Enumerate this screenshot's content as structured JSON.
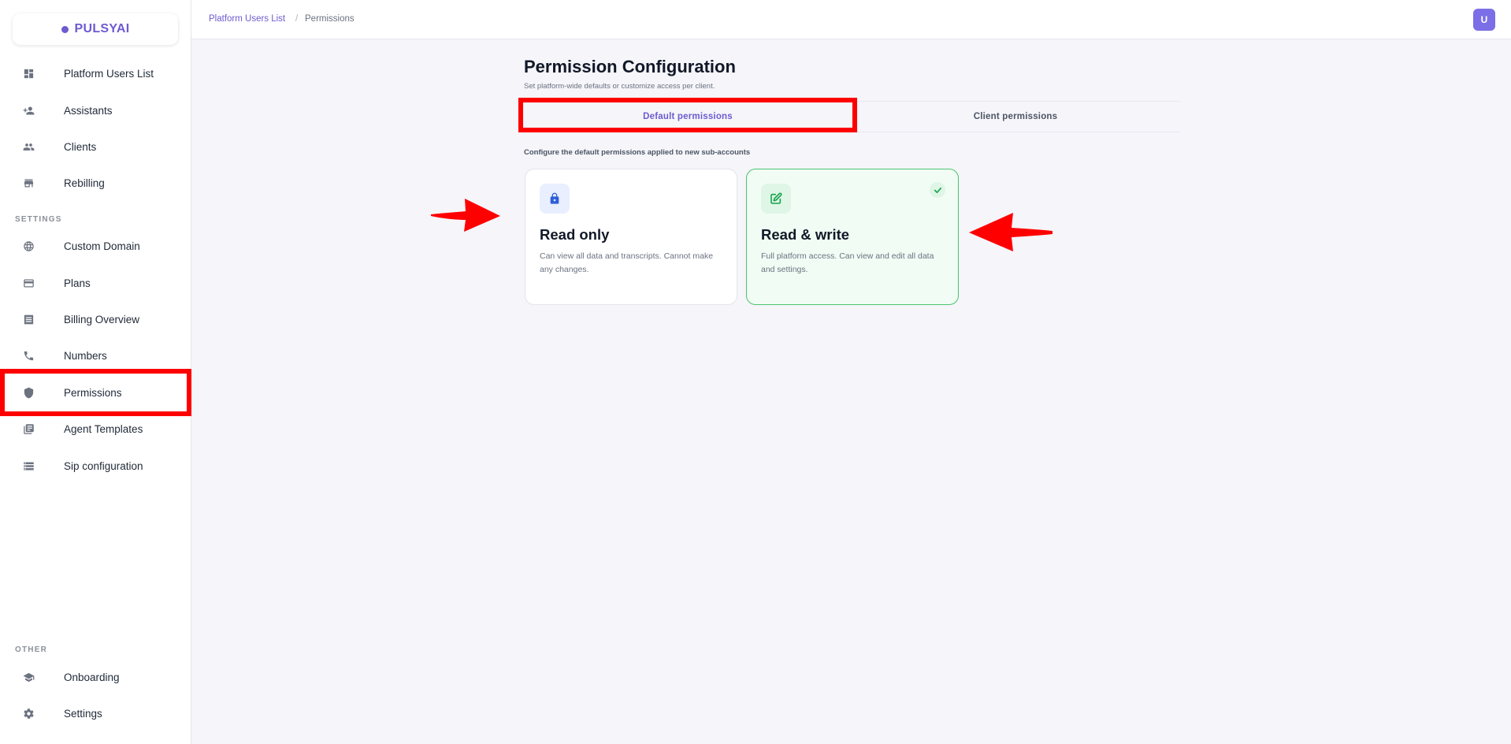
{
  "brand": {
    "name": "PULSYAI",
    "color": "#6d5bd0"
  },
  "sidebar": {
    "main_items": [
      {
        "label": "Platform Users List",
        "icon": "dashboard-icon"
      },
      {
        "label": "Assistants",
        "icon": "person-add-icon"
      },
      {
        "label": "Clients",
        "icon": "group-icon"
      },
      {
        "label": "Rebilling",
        "icon": "store-icon"
      }
    ],
    "settings_title": "SETTINGS",
    "settings_items": [
      {
        "label": "Custom Domain",
        "icon": "globe-icon"
      },
      {
        "label": "Plans",
        "icon": "credit-card-icon"
      },
      {
        "label": "Billing Overview",
        "icon": "receipt-icon"
      },
      {
        "label": "Numbers",
        "icon": "phone-icon"
      },
      {
        "label": "Permissions",
        "icon": "shield-icon",
        "selected": true
      },
      {
        "label": "Agent Templates",
        "icon": "library-icon"
      },
      {
        "label": "Sip configuration",
        "icon": "storage-icon"
      }
    ],
    "other_title": "OTHER",
    "other_items": [
      {
        "label": "Onboarding",
        "icon": "graduation-cap-icon"
      },
      {
        "label": "Settings",
        "icon": "gear-icon"
      }
    ]
  },
  "header": {
    "breadcrumb": {
      "parent": "Platform Users List",
      "separator": "/",
      "current": "Permissions"
    },
    "avatar_initial": "U"
  },
  "main": {
    "title": "Permission Configuration",
    "subtitle": "Set platform-wide defaults or customize access per client.",
    "tabs": [
      {
        "label": "Default permissions",
        "active": true
      },
      {
        "label": "Client permissions",
        "active": false
      }
    ],
    "config_note": "Configure the default permissions applied to new sub-accounts",
    "cards": [
      {
        "title": "Read only",
        "description": "Can view all data and transcripts. Cannot make any changes.",
        "icon": "lock-icon",
        "selected": false
      },
      {
        "title": "Read & write",
        "description": "Full platform access. Can view and edit all data and settings.",
        "icon": "edit-icon",
        "selected": true
      }
    ]
  },
  "colors": {
    "accent": "#6d5bd0",
    "annotation_red": "#ff0000",
    "selected_green": "#4cc46e"
  }
}
